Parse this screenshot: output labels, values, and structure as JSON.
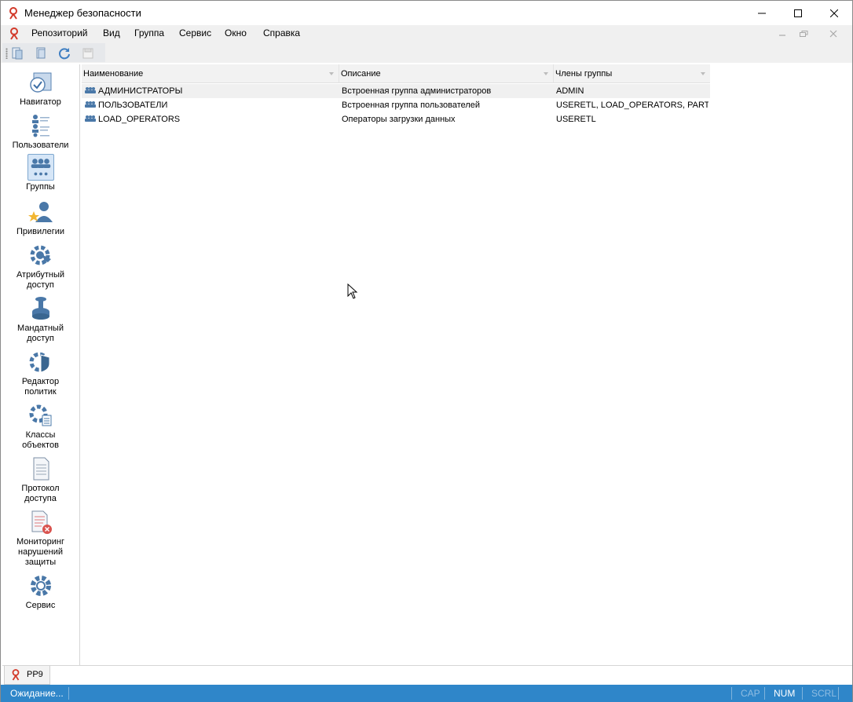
{
  "window": {
    "title": "Менеджер безопасности"
  },
  "menu": {
    "items": [
      "Репозиторий",
      "Вид",
      "Группа",
      "Сервис",
      "Окно",
      "Справка"
    ]
  },
  "navigator": {
    "items": [
      {
        "label": "Навигатор",
        "icon": "navigator-icon"
      },
      {
        "label": "Пользователи",
        "icon": "users-icon"
      },
      {
        "label": "Группы",
        "icon": "groups-icon",
        "selected": true
      },
      {
        "label": "Привилегии",
        "icon": "privileges-icon"
      },
      {
        "label": "Атрибутный\nдоступ",
        "icon": "attribute-access-icon"
      },
      {
        "label": "Мандатный\nдоступ",
        "icon": "mandatory-access-icon"
      },
      {
        "label": "Редактор\nполитик",
        "icon": "policy-editor-icon"
      },
      {
        "label": "Классы\nобъектов",
        "icon": "object-classes-icon"
      },
      {
        "label": "Протокол\nдоступа",
        "icon": "access-log-icon"
      },
      {
        "label": "Мониторинг\nнарушений\nзащиты",
        "icon": "security-violations-icon"
      },
      {
        "label": "Сервис",
        "icon": "service-icon"
      }
    ]
  },
  "grid": {
    "columns": [
      "Наименование",
      "Описание",
      "Члены группы"
    ],
    "rows": [
      {
        "name": "АДМИНИСТРАТОРЫ",
        "description": "Встроенная группа администраторов",
        "members": "ADMIN"
      },
      {
        "name": "ПОЛЬЗОВАТЕЛИ",
        "description": "Встроенная группа пользователей",
        "members": "USERETL, LOAD_OPERATORS, PART..."
      },
      {
        "name": "LOAD_OPERATORS",
        "description": "Операторы загрузки данных",
        "members": "USERETL"
      }
    ]
  },
  "tabs": {
    "doc_tab": "PP9"
  },
  "status": {
    "text": "Ожидание...",
    "cap": "CAP",
    "num": "NUM",
    "scrl": "SCRL"
  },
  "colors": {
    "accent": "#2f86c9",
    "icon_blue": "#4a78a8",
    "selected_bg": "#d6e6f7"
  }
}
